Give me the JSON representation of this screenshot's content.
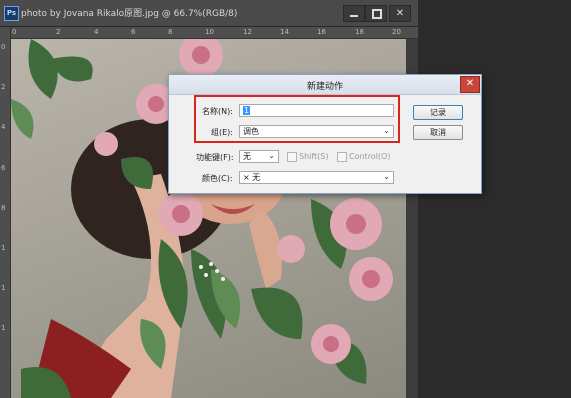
{
  "document": {
    "title": "photo by Jovana Rikalo原图.jpg @ 66.7%(RGB/8)",
    "app_icon": "Ps",
    "window_buttons": {
      "close": "✕"
    },
    "ruler_top": [
      "0",
      "2",
      "4",
      "6",
      "8",
      "10",
      "12",
      "14",
      "16",
      "18",
      "20"
    ],
    "ruler_left": [
      "0",
      "2",
      "4",
      "6",
      "8",
      "1",
      "1",
      "1"
    ]
  },
  "dialog": {
    "title": "新建动作",
    "close_label": "✕",
    "name_label": "名称(N):",
    "name_value": "1",
    "group_label": "组(E):",
    "group_value": "调色",
    "function_key_label": "功能键(F):",
    "function_key_value": "无",
    "shift_label": "Shift(S)",
    "control_label": "Control(O)",
    "color_label": "颜色(C):",
    "color_value": "× 无",
    "record_button": "记录",
    "cancel_button": "取消",
    "dropdown_arrow": "⌄"
  },
  "colors": {
    "highlight": "#d9261c",
    "selection": "#3399ff",
    "close_red": "#c9473a"
  }
}
